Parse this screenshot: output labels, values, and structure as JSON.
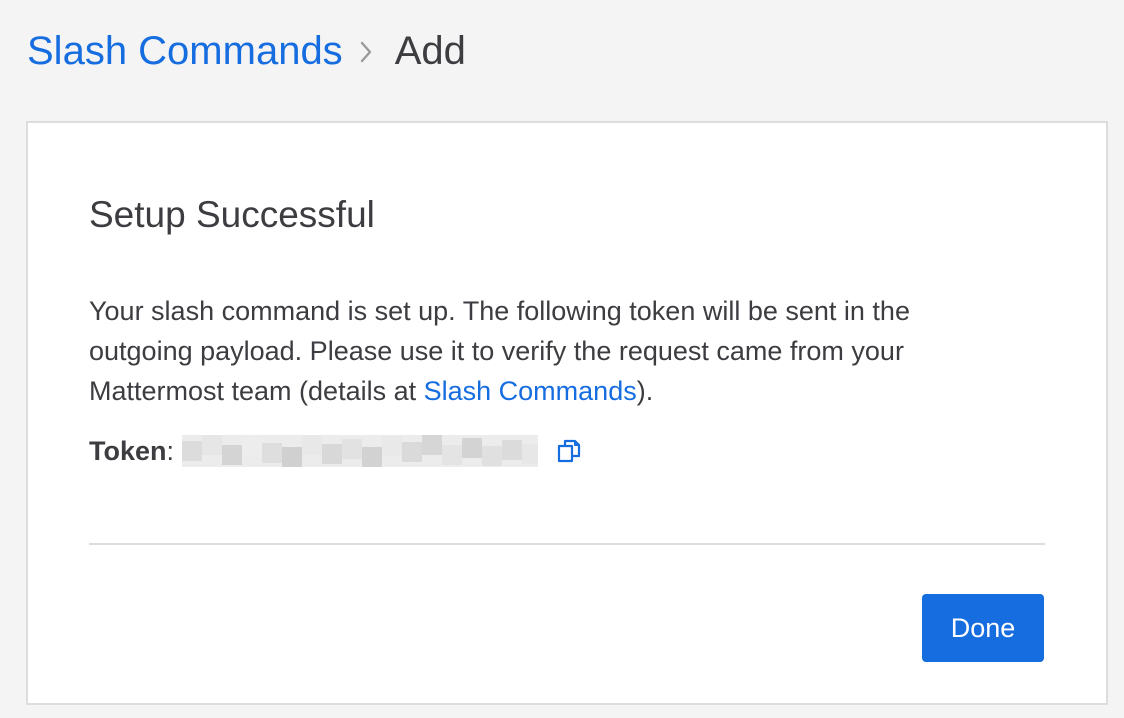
{
  "breadcrumb": {
    "parent": "Slash Commands",
    "current": "Add"
  },
  "card": {
    "title": "Setup Successful",
    "description_before": "Your slash command is set up. The following token will be sent in the outgoing payload. Please use it to verify the request came from your Mattermost team (details at ",
    "description_link": "Slash Commands",
    "description_after": ").",
    "token_label": "Token",
    "token_separator": ":",
    "done_label": "Done"
  },
  "icons": {
    "breadcrumb_separator": "chevron-right-icon",
    "copy": "copy-icon"
  },
  "colors": {
    "link": "#166de0",
    "button_bg": "#166de0",
    "text": "#3d3c40",
    "page_bg": "#f4f4f4"
  }
}
